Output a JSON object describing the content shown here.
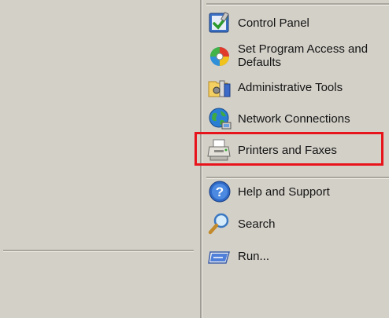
{
  "menu": {
    "items": [
      {
        "label": "Control Panel",
        "icon": "control-panel-icon"
      },
      {
        "label": "Set Program Access and Defaults",
        "icon": "program-access-icon"
      },
      {
        "label": "Administrative Tools",
        "icon": "admin-tools-icon"
      },
      {
        "label": "Network Connections",
        "icon": "network-connections-icon"
      },
      {
        "label": "Printers and Faxes",
        "icon": "printer-icon"
      },
      {
        "label": "Help and Support",
        "icon": "help-icon"
      },
      {
        "label": "Search",
        "icon": "search-icon"
      },
      {
        "label": "Run...",
        "icon": "run-icon"
      }
    ]
  },
  "highlight": {
    "color": "#e8141c",
    "target": "Printers and Faxes"
  },
  "colors": {
    "background": "#d4d0c8",
    "text": "#141414"
  }
}
